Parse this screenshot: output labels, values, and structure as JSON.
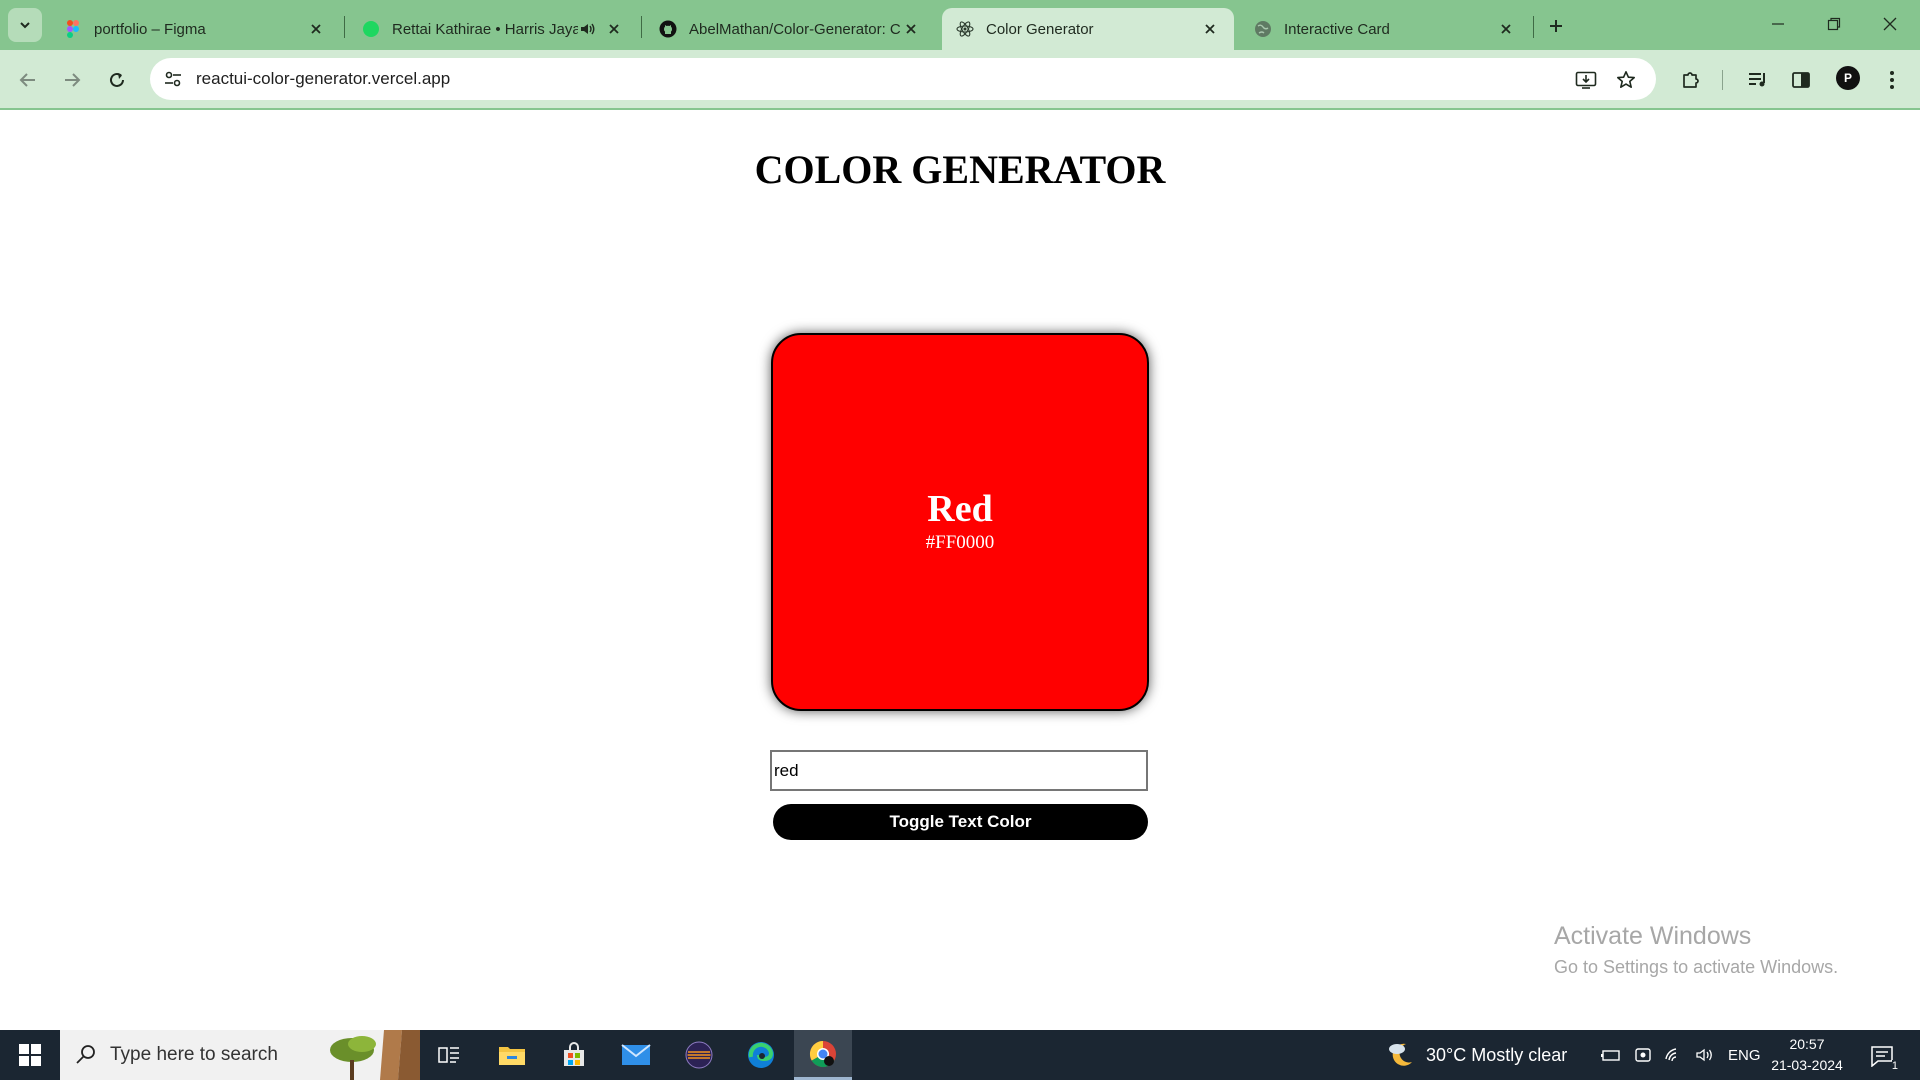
{
  "tabs": [
    {
      "label": "portfolio – Figma",
      "icon": "figma-icon"
    },
    {
      "label": "Rettai Kathirae • Harris Jaya",
      "icon": "music-icon"
    },
    {
      "label": "AbelMathan/Color-Generator: C",
      "icon": "github-icon"
    },
    {
      "label": "Color Generator",
      "icon": "react-icon"
    },
    {
      "label": "Interactive Card",
      "icon": "globe-icon"
    }
  ],
  "active_tab": "Color Generator",
  "address_bar": {
    "url": "reactui-color-generator.vercel.app"
  },
  "profile_initial": "P",
  "page": {
    "title": "COLOR GENERATOR",
    "color_name": "Red",
    "color_hex": "#FF0000",
    "input_value": "red",
    "toggle_button_label": "Toggle Text Color"
  },
  "watermark": {
    "line1": "Activate Windows",
    "line2": "Go to Settings to activate Windows."
  },
  "taskbar": {
    "search_placeholder": "Type here to search",
    "weather": "30°C  Mostly clear",
    "language": "ENG",
    "time": "20:57",
    "date": "21-03-2024",
    "notification_count": "1"
  },
  "colors": {
    "swatch": "#FF0000",
    "browser_frame": "#86C58F",
    "toolbar": "#D2EAD4",
    "taskbar": "#1B2632"
  }
}
